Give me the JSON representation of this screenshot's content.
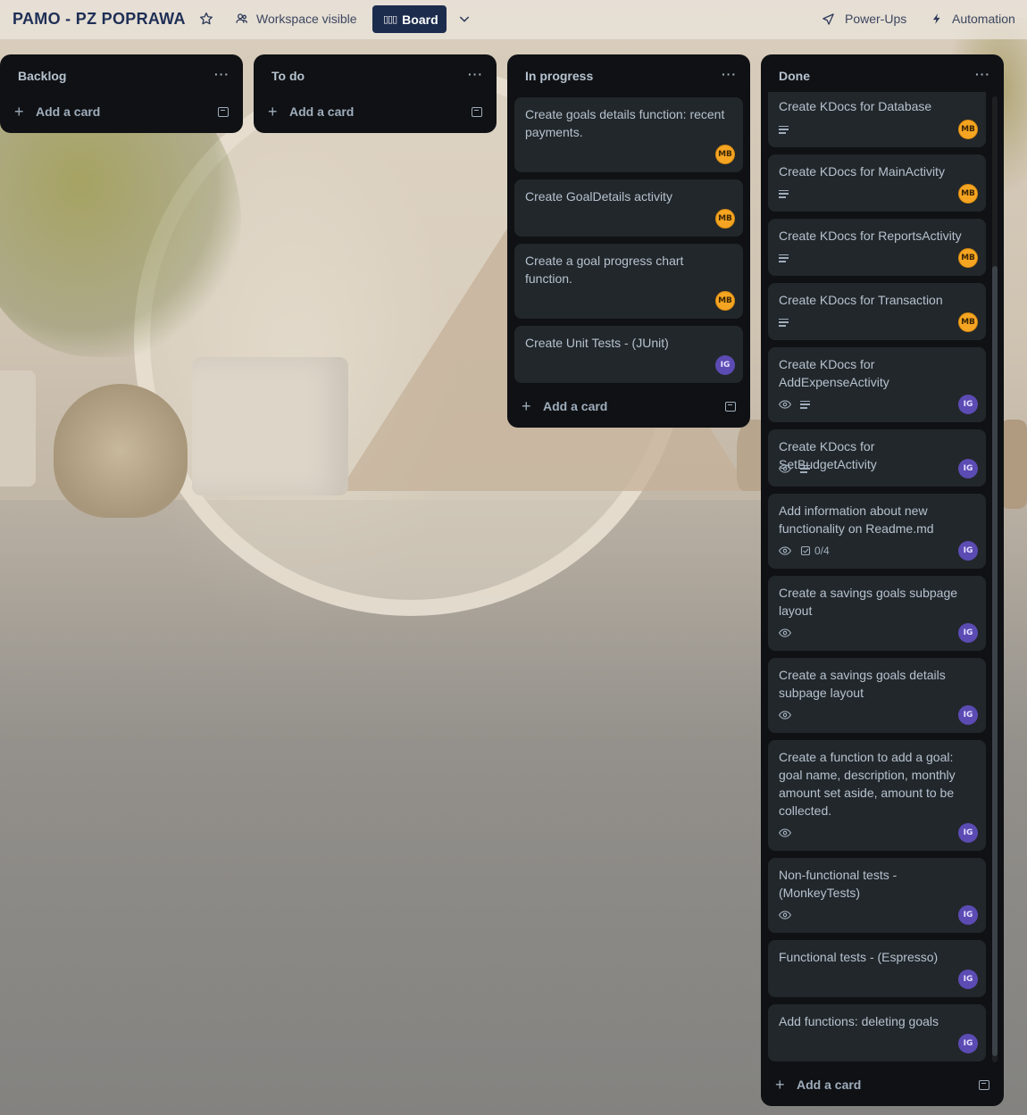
{
  "header": {
    "board_title": "PAMO - PZ POPRAWA",
    "visibility": "Workspace visible",
    "view_label": "Board",
    "powerups": "Power-Ups",
    "automation": "Automation"
  },
  "lists": [
    {
      "title": "Backlog",
      "add_label": "Add a card",
      "cards": []
    },
    {
      "title": "To do",
      "add_label": "Add a card",
      "cards": []
    },
    {
      "title": "In progress",
      "add_label": "Add a card",
      "cards": [
        {
          "title": "Create goals details function: recent payments.",
          "member": "MB"
        },
        {
          "title": "Create GoalDetails activity",
          "member": "MB"
        },
        {
          "title": "Create a goal progress chart function.",
          "member": "MB"
        },
        {
          "title": "Create Unit Tests - (JUnit)",
          "member": "IG"
        }
      ]
    },
    {
      "title": "Done",
      "add_label": "Add a card",
      "cards": [
        {
          "title": "Create KDocs for Database",
          "member": "MB"
        },
        {
          "title": "Create KDocs for MainActivity",
          "member": "MB"
        },
        {
          "title": "Create KDocs for ReportsActivity",
          "member": "MB"
        },
        {
          "title": "Create KDocs for Transaction",
          "member": "MB"
        },
        {
          "title": "Create KDocs for AddExpenseActivity",
          "member": "IG"
        },
        {
          "title": "Create KDocs for SetBudgetActivity",
          "member": "IG"
        },
        {
          "title": "Add information about new functionality on Readme.md",
          "member": "IG",
          "checklist": "0/4"
        },
        {
          "title": "Create a savings goals subpage layout",
          "member": "IG"
        },
        {
          "title": "Create a savings goals details subpage layout",
          "member": "IG"
        },
        {
          "title": "Create a function to add a goal: goal name, description, monthly amount set aside, amount to be collected.",
          "member": "IG"
        },
        {
          "title": "Non-functional tests - (MonkeyTests)",
          "member": "IG"
        },
        {
          "title": "Functional tests - (Espresso)",
          "member": "IG"
        },
        {
          "title": "Add functions: deleting goals",
          "member": "IG"
        }
      ]
    }
  ],
  "colors": {
    "list_bg": "#0f1114",
    "card_bg": "#22272b",
    "text": "#b6c2cf",
    "avatar_mb": "#f5a522",
    "avatar_ig": "#5b4bb3",
    "board_button": "#1c2c4d"
  }
}
